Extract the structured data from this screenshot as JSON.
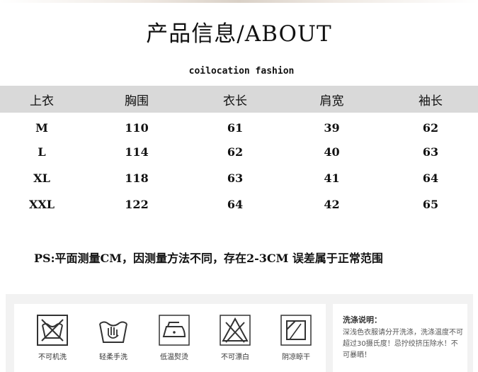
{
  "title": "产品信息/ABOUT",
  "subtitle": "coilocation fashion",
  "table": {
    "headers": [
      "上衣",
      "胸围",
      "衣长",
      "肩宽",
      "袖长"
    ],
    "rows": [
      [
        "M",
        "110",
        "61",
        "39",
        "62"
      ],
      [
        "L",
        "114",
        "62",
        "40",
        "63"
      ],
      [
        "XL",
        "118",
        "63",
        "41",
        "64"
      ],
      [
        "XXL",
        "122",
        "64",
        "42",
        "65"
      ]
    ]
  },
  "note": "PS:平面测量CM，因测量方法不同，存在2-3CM 误差属于正常范围",
  "care": {
    "items": [
      {
        "label": "不可机洗",
        "icon": "no-machine-wash-icon"
      },
      {
        "label": "轻柔手洗",
        "icon": "hand-wash-icon"
      },
      {
        "label": "低温熨烫",
        "icon": "low-iron-icon"
      },
      {
        "label": "不可漂白",
        "icon": "no-bleach-icon"
      },
      {
        "label": "阴凉晾干",
        "icon": "shade-dry-icon"
      }
    ],
    "instructions_title": "洗涤说明：",
    "instructions_text": "深浅色衣服请分开洗涤，洗涤温度不可超过30摄氏度！忌拧绞挤压除水！不可暴晒！"
  },
  "colors": {
    "header_bg": "#d9d9d9",
    "panel_bg": "#f2f2f2",
    "text": "#111111"
  }
}
